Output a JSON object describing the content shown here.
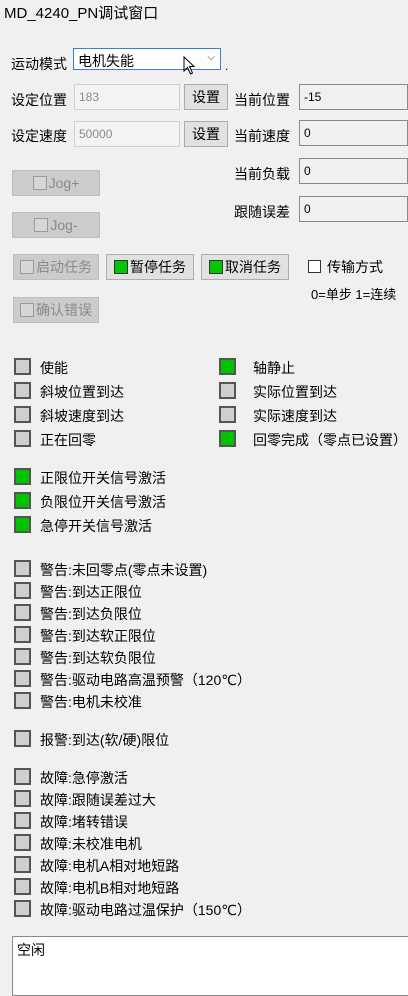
{
  "window_title": "MD_4240_PN调试窗口",
  "mode": {
    "label": "运动模式",
    "selected": "电机失能",
    "suffix": "."
  },
  "set_position": {
    "label": "设定位置",
    "value": "183",
    "button": "设置"
  },
  "set_speed": {
    "label": "设定速度",
    "value": "50000",
    "button": "设置"
  },
  "current": {
    "position_label": "当前位置",
    "position_value": "-15",
    "speed_label": "当前速度",
    "speed_value": "0",
    "load_label": "当前负载",
    "load_value": "0",
    "error_label": "跟随误差",
    "error_value": "0"
  },
  "jog": {
    "plus": "Jog+",
    "minus": "Jog-"
  },
  "tasks": {
    "start": "启动任务",
    "pause": "暂停任务",
    "cancel": "取消任务",
    "confirm_error": "确认错误"
  },
  "transfer": {
    "label": "传输方式",
    "hint": "0=单步 1=连续"
  },
  "status_left": [
    {
      "text": "使能",
      "on": false
    },
    {
      "text": "斜坡位置到达",
      "on": false
    },
    {
      "text": "斜坡速度到达",
      "on": false
    },
    {
      "text": "正在回零",
      "on": false
    }
  ],
  "status_right": [
    {
      "text": "轴静止",
      "on": true
    },
    {
      "text": "实际位置到达",
      "on": false
    },
    {
      "text": "实际速度到达",
      "on": false
    },
    {
      "text": "回零完成（零点已设置）",
      "on": true
    }
  ],
  "limits": [
    {
      "text": "正限位开关信号激活",
      "on": true
    },
    {
      "text": "负限位开关信号激活",
      "on": true
    },
    {
      "text": "急停开关信号激活",
      "on": true
    }
  ],
  "warnings": [
    {
      "text": "警告:未回零点(零点未设置)",
      "on": false
    },
    {
      "text": "警告:到达正限位",
      "on": false
    },
    {
      "text": "警告:到达负限位",
      "on": false
    },
    {
      "text": "警告:到达软正限位",
      "on": false
    },
    {
      "text": "警告:到达软负限位",
      "on": false
    },
    {
      "text": "警告:驱动电路高温预警（120℃）",
      "on": false
    },
    {
      "text": "警告:电机未校准",
      "on": false
    }
  ],
  "alarm": {
    "text": "报警:到达(软/硬)限位",
    "on": false
  },
  "faults": [
    {
      "text": "故障:急停激活",
      "on": false
    },
    {
      "text": "故障:跟随误差过大",
      "on": false
    },
    {
      "text": "故障:堵转错误",
      "on": false
    },
    {
      "text": "故障:未校准电机",
      "on": false
    },
    {
      "text": "故障:电机A相对地短路",
      "on": false
    },
    {
      "text": "故障:电机B相对地短路",
      "on": false
    },
    {
      "text": "故障:驱动电路过温保护（150℃）",
      "on": false
    }
  ],
  "status_box": "空闲",
  "colors": {
    "indicator_on": "#00c400",
    "indicator_off": "#cfcfcf",
    "select_border": "#3c7fd1"
  },
  "icons": {
    "dropdown": "chevron-down-icon",
    "cursor": "mouse-pointer-icon"
  }
}
